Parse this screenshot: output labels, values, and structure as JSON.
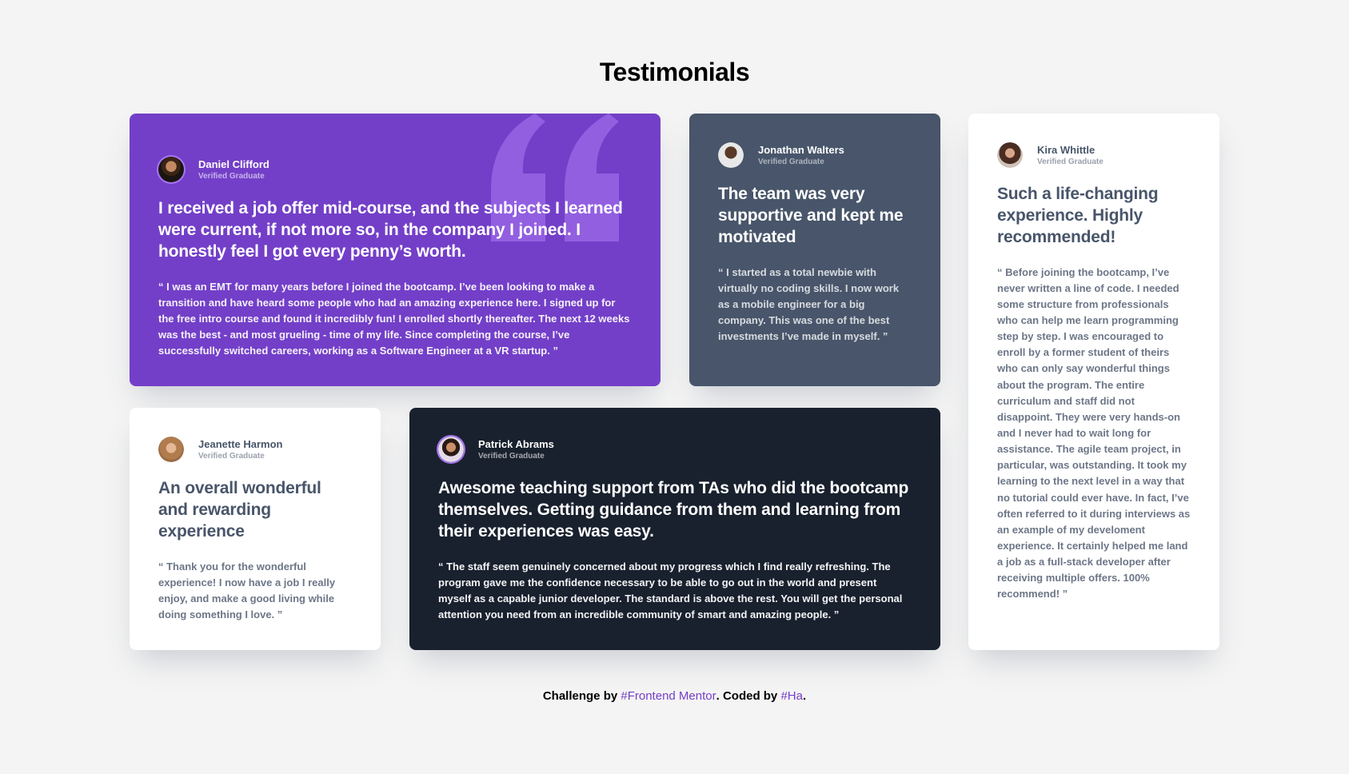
{
  "page": {
    "title": "Testimonials"
  },
  "colors": {
    "purple": "#733fc8",
    "gray": "#48556a",
    "white": "#ffffff",
    "dark": "#19212e",
    "background": "#f4f4f4",
    "link": "#733fc8"
  },
  "testimonials": [
    {
      "name": "Daniel Clifford",
      "badge": "Verified Graduate",
      "headline": "I received a job offer mid-course, and the subjects I learned were current, if not more so, in the company I joined. I honestly feel I got every penny’s worth.",
      "body": "“ I was an EMT for many years before I joined the bootcamp. I’ve been looking to make a transition and have heard some people who had an amazing experience here. I signed up for the free intro course and found it incredibly fun! I enrolled shortly thereafter. The next 12 weeks was the best - and most grueling - time of my life. Since completing the course, I’ve successfully switched careers, working as a Software Engineer at a VR startup. ”",
      "theme": "purple",
      "avatar_icon": "avatar-daniel-icon"
    },
    {
      "name": "Jonathan Walters",
      "badge": "Verified Graduate",
      "headline": "The team was very supportive and kept me motivated",
      "body": "“ I started as a total newbie with virtually no coding skills. I now work as a mobile engineer for a big company. This was one of the best investments I’ve made in myself. ”",
      "theme": "gray",
      "avatar_icon": "avatar-jonathan-icon"
    },
    {
      "name": "Kira Whittle",
      "badge": "Verified Graduate",
      "headline": "Such a life-changing experience. Highly recommended!",
      "body": "“ Before joining the bootcamp, I’ve never written a line of code. I needed some structure from professionals who can help me learn programming step by step. I was encouraged to enroll by a former student of theirs who can only say wonderful things about the program. The entire curriculum and staff did not disappoint. They were very hands-on and I never had to wait long for assistance. The agile team project, in particular, was outstanding. It took my learning to the next level in a way that no tutorial could ever have. In fact, I’ve often referred to it during interviews as an example of my develoment experience. It certainly helped me land a job as a full-stack developer after receiving multiple offers. 100% recommend! ”",
      "theme": "white",
      "avatar_icon": "avatar-kira-icon"
    },
    {
      "name": "Jeanette Harmon",
      "badge": "Verified Graduate",
      "headline": "An overall wonderful and rewarding experience",
      "body": "“ Thank you for the wonderful experience! I now have a job I really enjoy, and make a good living while doing something I love. ”",
      "theme": "white",
      "avatar_icon": "avatar-jeanette-icon"
    },
    {
      "name": "Patrick Abrams",
      "badge": "Verified Graduate",
      "headline": "Awesome teaching support from TAs who did the bootcamp themselves. Getting guidance from them and learning from their experiences was easy.",
      "body": "“ The staff seem genuinely concerned about my progress which I find really refreshing. The program gave me the confidence necessary to be able to go out in the world and present myself as a capable junior developer. The standard is above the rest. You will get the personal attention you need from an incredible community of smart and amazing people. ”",
      "theme": "dark",
      "avatar_icon": "avatar-patrick-icon"
    }
  ],
  "footer": {
    "prefix": "Challenge by ",
    "link1": "#Frontend Mentor",
    "middle": ". Coded by ",
    "link2": "#Ha",
    "suffix": "."
  },
  "decoration": {
    "quote_icon": "quote-mark-icon"
  }
}
